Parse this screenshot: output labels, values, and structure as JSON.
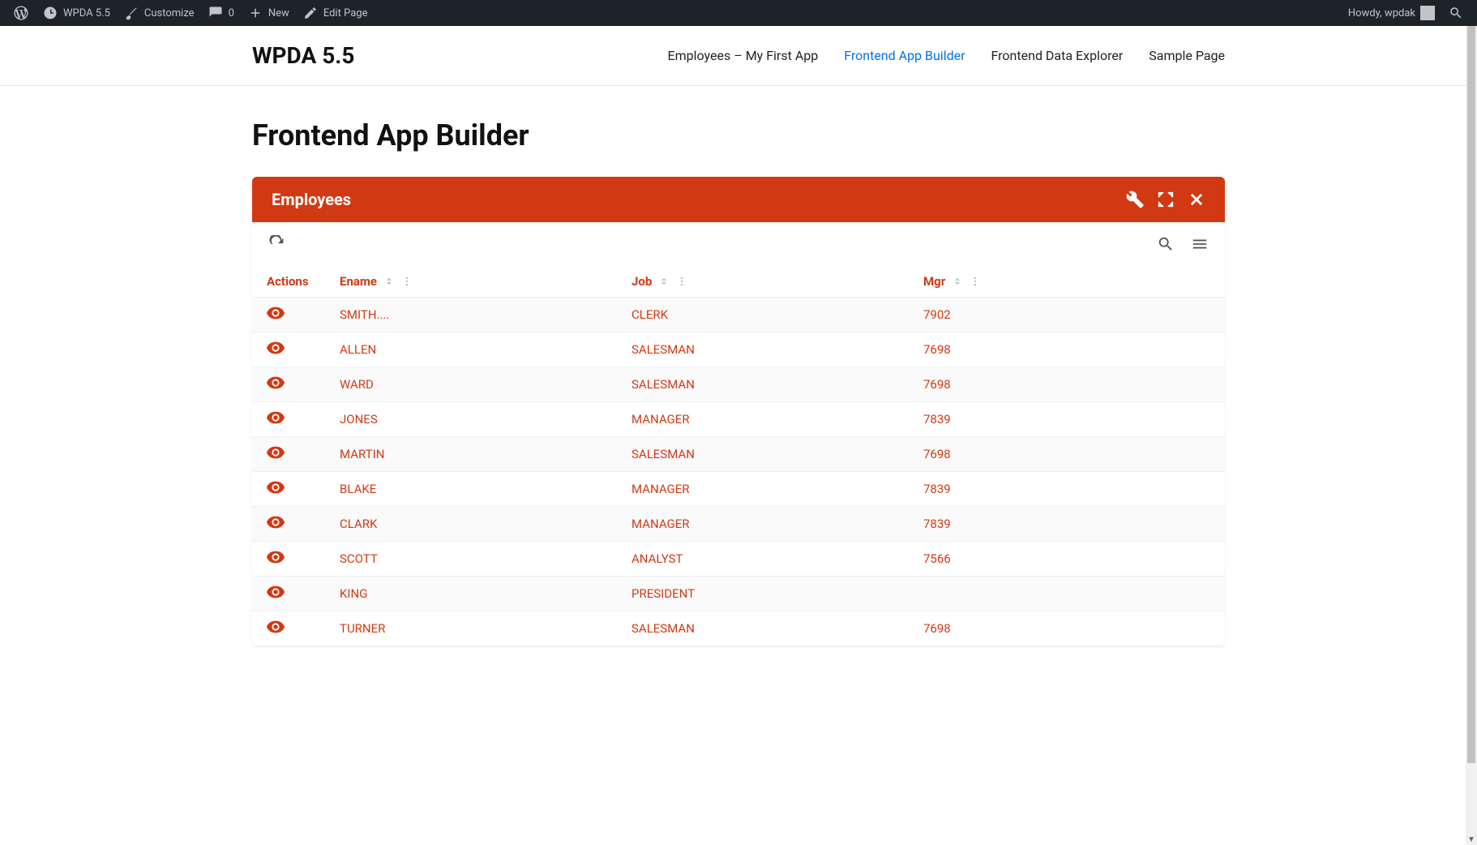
{
  "admin_bar": {
    "site_name": "WPDA 5.5",
    "customize": "Customize",
    "comments_count": "0",
    "new_label": "New",
    "edit_page": "Edit Page",
    "howdy": "Howdy, wpdak"
  },
  "site": {
    "title": "WPDA 5.5",
    "nav": [
      {
        "label": "Employees – My First App",
        "active": false
      },
      {
        "label": "Frontend App Builder",
        "active": true
      },
      {
        "label": "Frontend Data Explorer",
        "active": false
      },
      {
        "label": "Sample Page",
        "active": false
      }
    ]
  },
  "page": {
    "title": "Frontend App Builder"
  },
  "panel": {
    "title": "Employees"
  },
  "table": {
    "columns": {
      "actions": "Actions",
      "ename": "Ename",
      "job": "Job",
      "mgr": "Mgr"
    },
    "rows": [
      {
        "ename": "SMITH....",
        "job": "CLERK",
        "mgr": "7902"
      },
      {
        "ename": "ALLEN",
        "job": "SALESMAN",
        "mgr": "7698"
      },
      {
        "ename": "WARD",
        "job": "SALESMAN",
        "mgr": "7698"
      },
      {
        "ename": "JONES",
        "job": "MANAGER",
        "mgr": "7839"
      },
      {
        "ename": "MARTIN",
        "job": "SALESMAN",
        "mgr": "7698"
      },
      {
        "ename": "BLAKE",
        "job": "MANAGER",
        "mgr": "7839"
      },
      {
        "ename": "CLARK",
        "job": "MANAGER",
        "mgr": "7839"
      },
      {
        "ename": "SCOTT",
        "job": "ANALYST",
        "mgr": "7566"
      },
      {
        "ename": "KING",
        "job": "PRESIDENT",
        "mgr": ""
      },
      {
        "ename": "TURNER",
        "job": "SALESMAN",
        "mgr": "7698"
      }
    ]
  }
}
